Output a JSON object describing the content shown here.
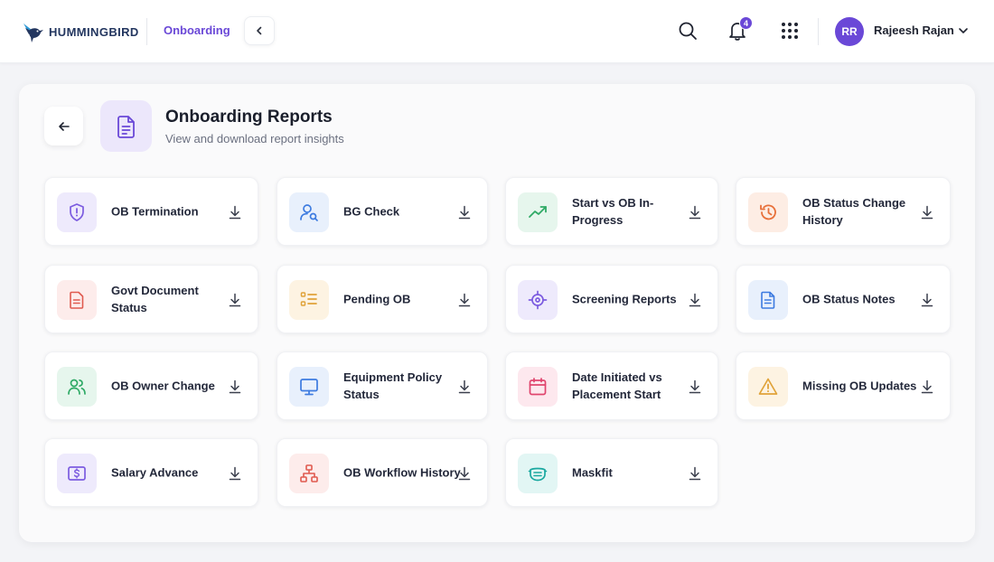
{
  "app": {
    "brand": "HUMMINGBIRD",
    "breadcrumb": "Onboarding"
  },
  "header": {
    "notification_count": "4",
    "user": {
      "initials": "RR",
      "name": "Rajeesh Rajan"
    }
  },
  "page": {
    "title": "Onboarding Reports",
    "subtitle": "View and download report insights"
  },
  "colors": {
    "accent": "#6a48d7",
    "purple": "#7c5ce0",
    "blue": "#3d7be0",
    "green": "#2faa66",
    "orange": "#e8703a",
    "red": "#e05a4f",
    "amber": "#e0a33a",
    "teal": "#1aa8a0",
    "pink": "#e0456e"
  },
  "reports": [
    {
      "label": "OB Termination",
      "icon": "shield-alert-icon",
      "theme": "purple"
    },
    {
      "label": "BG Check",
      "icon": "user-search-icon",
      "theme": "blue"
    },
    {
      "label": "Start vs OB In-Progress",
      "icon": "trending-up-icon",
      "theme": "green"
    },
    {
      "label": "OB Status Change History",
      "icon": "history-icon",
      "theme": "orange"
    },
    {
      "label": "Govt Document Status",
      "icon": "document-icon",
      "theme": "red"
    },
    {
      "label": "Pending OB",
      "icon": "list-icon",
      "theme": "amber"
    },
    {
      "label": "Screening Reports",
      "icon": "target-icon",
      "theme": "purple"
    },
    {
      "label": "OB Status Notes",
      "icon": "notes-icon",
      "theme": "blue"
    },
    {
      "label": "OB Owner Change",
      "icon": "users-icon",
      "theme": "green"
    },
    {
      "label": "Equipment Policy Status",
      "icon": "monitor-icon",
      "theme": "blue"
    },
    {
      "label": "Date Initiated vs Placement Start",
      "icon": "calendar-icon",
      "theme": "pink"
    },
    {
      "label": "Missing OB Updates",
      "icon": "warning-icon",
      "theme": "amber"
    },
    {
      "label": "Salary Advance",
      "icon": "dollar-icon",
      "theme": "purple"
    },
    {
      "label": "OB Workflow History",
      "icon": "workflow-icon",
      "theme": "red"
    },
    {
      "label": "Maskfit",
      "icon": "mask-icon",
      "theme": "teal"
    }
  ]
}
